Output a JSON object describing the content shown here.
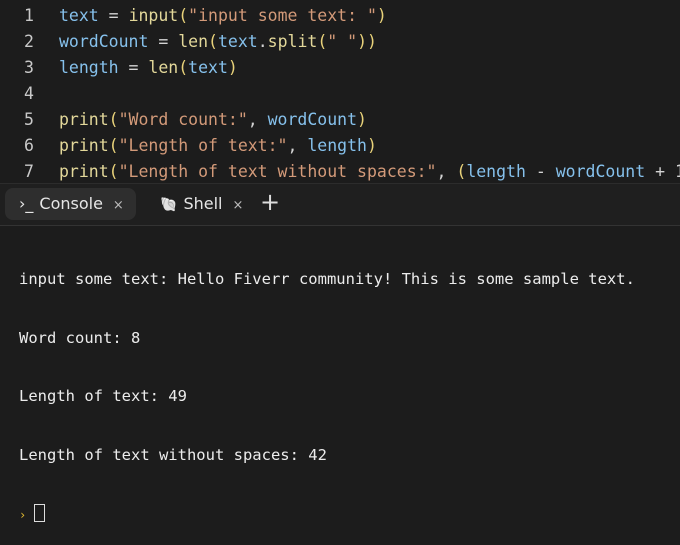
{
  "editor": {
    "lines": [
      {
        "num": "1",
        "tokens": [
          [
            "text",
            "var"
          ],
          [
            " = ",
            "op"
          ],
          [
            "input",
            "fn"
          ],
          [
            "(",
            "paren"
          ],
          [
            "\"input some text: \"",
            "str"
          ],
          [
            ")",
            "paren"
          ]
        ]
      },
      {
        "num": "2",
        "tokens": [
          [
            "wordCount",
            "var"
          ],
          [
            " = ",
            "op"
          ],
          [
            "len",
            "fn"
          ],
          [
            "(",
            "paren"
          ],
          [
            "text",
            "var"
          ],
          [
            ".",
            "op"
          ],
          [
            "split",
            "fn"
          ],
          [
            "(",
            "paren"
          ],
          [
            "\" \"",
            "str"
          ],
          [
            "))",
            "paren"
          ]
        ]
      },
      {
        "num": "3",
        "tokens": [
          [
            "length",
            "var"
          ],
          [
            " = ",
            "op"
          ],
          [
            "len",
            "fn"
          ],
          [
            "(",
            "paren"
          ],
          [
            "text",
            "var"
          ],
          [
            ")",
            "paren"
          ]
        ]
      },
      {
        "num": "4",
        "tokens": []
      },
      {
        "num": "5",
        "tokens": [
          [
            "print",
            "fn"
          ],
          [
            "(",
            "paren"
          ],
          [
            "\"Word count:\"",
            "str"
          ],
          [
            ", ",
            "op"
          ],
          [
            "wordCount",
            "var"
          ],
          [
            ")",
            "paren"
          ]
        ]
      },
      {
        "num": "6",
        "tokens": [
          [
            "print",
            "fn"
          ],
          [
            "(",
            "paren"
          ],
          [
            "\"Length of text:\"",
            "str"
          ],
          [
            ", ",
            "op"
          ],
          [
            "length",
            "var"
          ],
          [
            ")",
            "paren"
          ]
        ]
      },
      {
        "num": "7",
        "tokens": [
          [
            "print",
            "fn"
          ],
          [
            "(",
            "paren"
          ],
          [
            "\"Length of text without spaces:\"",
            "str"
          ],
          [
            ", ",
            "op"
          ],
          [
            "(",
            "paren"
          ],
          [
            "length",
            "var"
          ],
          [
            " - ",
            "op"
          ],
          [
            "wordCount",
            "var"
          ],
          [
            " + 1",
            "op"
          ],
          [
            "))",
            "paren"
          ]
        ]
      }
    ]
  },
  "tabs": [
    {
      "icon": "terminal-icon",
      "glyph": "›_",
      "label": "Console",
      "close": "×",
      "active": true
    },
    {
      "icon": "shell-icon",
      "glyph": "🐚",
      "label": "Shell",
      "close": "×",
      "active": false
    }
  ],
  "add_tab": "+",
  "console": {
    "output": [
      "input some text: Hello Fiverr community! This is some sample text.",
      "Word count: 8",
      "Length of text: 49",
      "Length of text without spaces: 42"
    ],
    "prompt": "›"
  }
}
